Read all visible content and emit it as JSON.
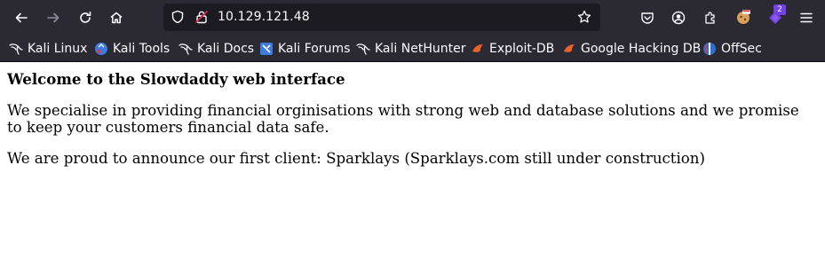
{
  "browser": {
    "url": "10.129.121.48",
    "extensions_badge_count": "2"
  },
  "bookmarks": [
    {
      "label": "Kali Linux",
      "icon": "kali-dragon-icon"
    },
    {
      "label": "Kali Tools",
      "icon": "kali-tools-icon"
    },
    {
      "label": "Kali Docs",
      "icon": "kali-dragon-icon"
    },
    {
      "label": "Kali Forums",
      "icon": "kali-forums-icon"
    },
    {
      "label": "Kali NetHunter",
      "icon": "kali-dragon-icon"
    },
    {
      "label": "Exploit-DB",
      "icon": "exploit-db-icon"
    },
    {
      "label": "Google Hacking DB",
      "icon": "exploit-db-icon"
    },
    {
      "label": "OffSec",
      "icon": "offsec-icon"
    }
  ],
  "page": {
    "heading": "Welcome to the Slowdaddy web interface",
    "paragraph1": "We specialise in providing financial orginisations with strong web and database solutions and we promise to keep your customers financial data safe.",
    "paragraph2": "We are proud to announce our first client: Sparklays (Sparklays.com still under construction)"
  },
  "colors": {
    "toolbar_bg": "#2b2a33",
    "urlbar_bg": "#1c1b22",
    "text_light": "#fbfbfe",
    "page_bg": "#ffffff"
  }
}
